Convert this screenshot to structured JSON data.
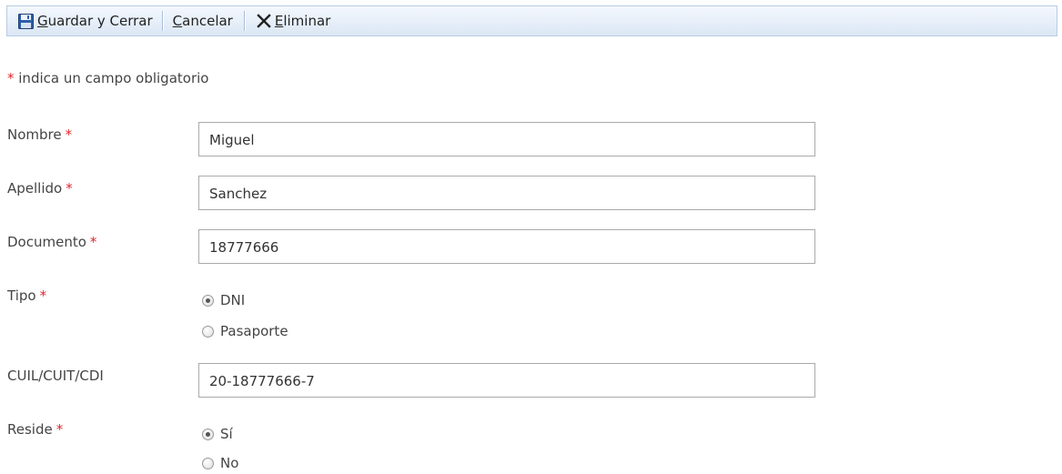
{
  "toolbar": {
    "save": {
      "accesskey": "G",
      "rest": "uardar y Cerrar",
      "icon": "floppy-disk-icon"
    },
    "cancel": {
      "accesskey": "C",
      "rest": "ancelar"
    },
    "delete": {
      "accesskey": "E",
      "rest": "liminar",
      "icon": "x-icon"
    }
  },
  "hint": {
    "asterisk": "*",
    "text": " indica un campo obligatorio"
  },
  "form": {
    "required_mark": "*",
    "nombre": {
      "label": "Nombre",
      "value": "Miguel"
    },
    "apellido": {
      "label": "Apellido",
      "value": "Sanchez"
    },
    "documento": {
      "label": "Documento",
      "value": "18777666"
    },
    "tipo": {
      "label": "Tipo",
      "options": [
        "DNI",
        "Pasaporte"
      ],
      "selected": "DNI"
    },
    "cuil": {
      "label": "CUIL/CUIT/CDI",
      "value": "20-18777666-7"
    },
    "reside": {
      "label": "Reside",
      "options": [
        "Sí",
        "No"
      ],
      "selected": "Sí"
    }
  },
  "colors": {
    "required": "#e0252a",
    "toolbar_border": "#b8cce4",
    "input_border": "#aaaaaa"
  }
}
